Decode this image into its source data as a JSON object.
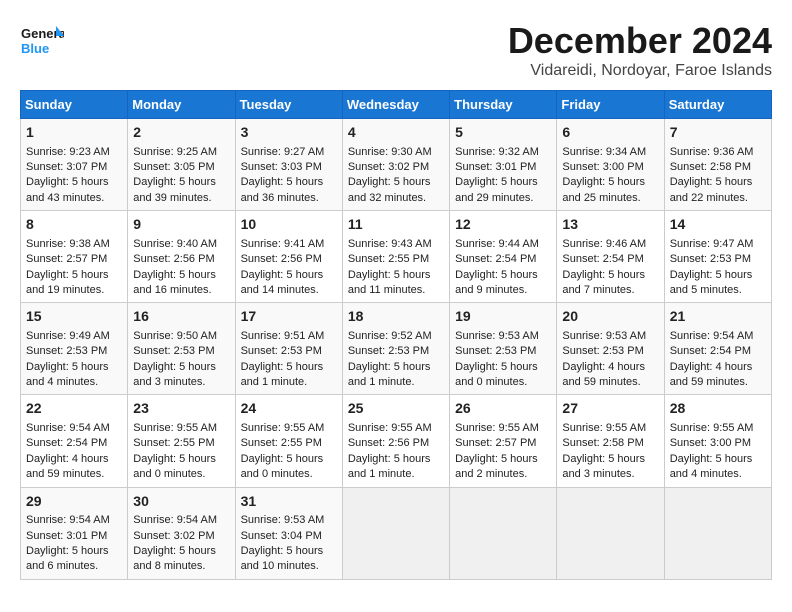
{
  "header": {
    "logo_line1": "General",
    "logo_line2": "Blue",
    "title": "December 2024",
    "subtitle": "Vidareidi, Nordoyar, Faroe Islands"
  },
  "days_of_week": [
    "Sunday",
    "Monday",
    "Tuesday",
    "Wednesday",
    "Thursday",
    "Friday",
    "Saturday"
  ],
  "weeks": [
    [
      {
        "day": "1",
        "sunrise": "9:23 AM",
        "sunset": "3:07 PM",
        "daylight": "5 hours and 43 minutes."
      },
      {
        "day": "2",
        "sunrise": "9:25 AM",
        "sunset": "3:05 PM",
        "daylight": "5 hours and 39 minutes."
      },
      {
        "day": "3",
        "sunrise": "9:27 AM",
        "sunset": "3:03 PM",
        "daylight": "5 hours and 36 minutes."
      },
      {
        "day": "4",
        "sunrise": "9:30 AM",
        "sunset": "3:02 PM",
        "daylight": "5 hours and 32 minutes."
      },
      {
        "day": "5",
        "sunrise": "9:32 AM",
        "sunset": "3:01 PM",
        "daylight": "5 hours and 29 minutes."
      },
      {
        "day": "6",
        "sunrise": "9:34 AM",
        "sunset": "3:00 PM",
        "daylight": "5 hours and 25 minutes."
      },
      {
        "day": "7",
        "sunrise": "9:36 AM",
        "sunset": "2:58 PM",
        "daylight": "5 hours and 22 minutes."
      }
    ],
    [
      {
        "day": "8",
        "sunrise": "9:38 AM",
        "sunset": "2:57 PM",
        "daylight": "5 hours and 19 minutes."
      },
      {
        "day": "9",
        "sunrise": "9:40 AM",
        "sunset": "2:56 PM",
        "daylight": "5 hours and 16 minutes."
      },
      {
        "day": "10",
        "sunrise": "9:41 AM",
        "sunset": "2:56 PM",
        "daylight": "5 hours and 14 minutes."
      },
      {
        "day": "11",
        "sunrise": "9:43 AM",
        "sunset": "2:55 PM",
        "daylight": "5 hours and 11 minutes."
      },
      {
        "day": "12",
        "sunrise": "9:44 AM",
        "sunset": "2:54 PM",
        "daylight": "5 hours and 9 minutes."
      },
      {
        "day": "13",
        "sunrise": "9:46 AM",
        "sunset": "2:54 PM",
        "daylight": "5 hours and 7 minutes."
      },
      {
        "day": "14",
        "sunrise": "9:47 AM",
        "sunset": "2:53 PM",
        "daylight": "5 hours and 5 minutes."
      }
    ],
    [
      {
        "day": "15",
        "sunrise": "9:49 AM",
        "sunset": "2:53 PM",
        "daylight": "5 hours and 4 minutes."
      },
      {
        "day": "16",
        "sunrise": "9:50 AM",
        "sunset": "2:53 PM",
        "daylight": "5 hours and 3 minutes."
      },
      {
        "day": "17",
        "sunrise": "9:51 AM",
        "sunset": "2:53 PM",
        "daylight": "5 hours and 1 minute."
      },
      {
        "day": "18",
        "sunrise": "9:52 AM",
        "sunset": "2:53 PM",
        "daylight": "5 hours and 1 minute."
      },
      {
        "day": "19",
        "sunrise": "9:53 AM",
        "sunset": "2:53 PM",
        "daylight": "5 hours and 0 minutes."
      },
      {
        "day": "20",
        "sunrise": "9:53 AM",
        "sunset": "2:53 PM",
        "daylight": "4 hours and 59 minutes."
      },
      {
        "day": "21",
        "sunrise": "9:54 AM",
        "sunset": "2:54 PM",
        "daylight": "4 hours and 59 minutes."
      }
    ],
    [
      {
        "day": "22",
        "sunrise": "9:54 AM",
        "sunset": "2:54 PM",
        "daylight": "4 hours and 59 minutes."
      },
      {
        "day": "23",
        "sunrise": "9:55 AM",
        "sunset": "2:55 PM",
        "daylight": "5 hours and 0 minutes."
      },
      {
        "day": "24",
        "sunrise": "9:55 AM",
        "sunset": "2:55 PM",
        "daylight": "5 hours and 0 minutes."
      },
      {
        "day": "25",
        "sunrise": "9:55 AM",
        "sunset": "2:56 PM",
        "daylight": "5 hours and 1 minute."
      },
      {
        "day": "26",
        "sunrise": "9:55 AM",
        "sunset": "2:57 PM",
        "daylight": "5 hours and 2 minutes."
      },
      {
        "day": "27",
        "sunrise": "9:55 AM",
        "sunset": "2:58 PM",
        "daylight": "5 hours and 3 minutes."
      },
      {
        "day": "28",
        "sunrise": "9:55 AM",
        "sunset": "3:00 PM",
        "daylight": "5 hours and 4 minutes."
      }
    ],
    [
      {
        "day": "29",
        "sunrise": "9:54 AM",
        "sunset": "3:01 PM",
        "daylight": "5 hours and 6 minutes."
      },
      {
        "day": "30",
        "sunrise": "9:54 AM",
        "sunset": "3:02 PM",
        "daylight": "5 hours and 8 minutes."
      },
      {
        "day": "31",
        "sunrise": "9:53 AM",
        "sunset": "3:04 PM",
        "daylight": "5 hours and 10 minutes."
      },
      null,
      null,
      null,
      null
    ]
  ]
}
